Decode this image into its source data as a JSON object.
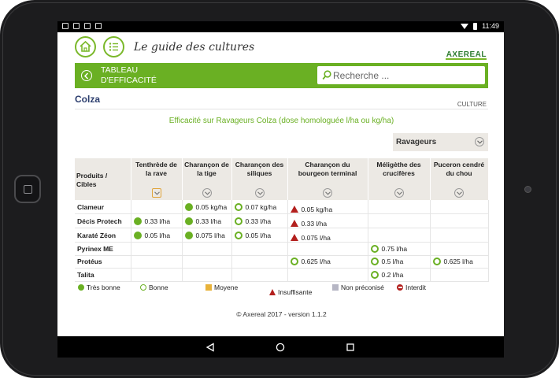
{
  "status_bar": {
    "time": "11:49"
  },
  "app": {
    "title": "Le guide des cultures",
    "logo": "AXEREAL"
  },
  "nav": {
    "title": "TABLEAU D'EFFICACITÉ",
    "search_placeholder": "Recherche ..."
  },
  "crop": {
    "name": "Colza",
    "label": "CULTURE"
  },
  "efficacy_title": "Efficacité sur Ravageurs Colza (dose homologuée l/ha ou kg/ha)",
  "filter": {
    "selected": "Ravageurs"
  },
  "table": {
    "header_first": "Produits / Cibles",
    "columns": [
      "Tenthrède de la rave",
      "Charançon de la tige",
      "Charançon des siliques",
      "Charançon du bourgeon terminal",
      "Méligèthe des crucifères",
      "Puceron cendré du chou"
    ],
    "rows": [
      {
        "product": "Clameur",
        "cells": [
          null,
          {
            "rating": "tres_bonne",
            "dose": "0.05 kg/ha"
          },
          {
            "rating": "bonne",
            "dose": "0.07 kg/ha"
          },
          {
            "rating": "insuffisante",
            "dose": "0.05 kg/ha"
          },
          null,
          null
        ]
      },
      {
        "product": "Décis Protech",
        "cells": [
          {
            "rating": "tres_bonne",
            "dose": "0.33 l/ha"
          },
          {
            "rating": "tres_bonne",
            "dose": "0.33 l/ha"
          },
          {
            "rating": "bonne",
            "dose": "0.33 l/ha"
          },
          {
            "rating": "insuffisante",
            "dose": "0.33 l/ha"
          },
          null,
          null
        ]
      },
      {
        "product": "Karaté Zéon",
        "cells": [
          {
            "rating": "tres_bonne",
            "dose": "0.05 l/ha"
          },
          {
            "rating": "tres_bonne",
            "dose": "0.075 l/ha"
          },
          {
            "rating": "bonne",
            "dose": "0.05 l/ha"
          },
          {
            "rating": "insuffisante",
            "dose": "0.075 l/ha"
          },
          null,
          null
        ]
      },
      {
        "product": "Pyrinex ME",
        "cells": [
          null,
          null,
          null,
          null,
          {
            "rating": "bonne",
            "dose": "0.75 l/ha"
          },
          null
        ]
      },
      {
        "product": "Protéus",
        "cells": [
          null,
          null,
          null,
          {
            "rating": "bonne",
            "dose": "0.625 l/ha"
          },
          {
            "rating": "bonne",
            "dose": "0.5 l/ha"
          },
          {
            "rating": "bonne",
            "dose": "0.625 l/ha"
          }
        ]
      },
      {
        "product": "Talita",
        "cells": [
          null,
          null,
          null,
          null,
          {
            "rating": "bonne",
            "dose": "0.2 l/ha"
          },
          null
        ]
      }
    ]
  },
  "legend": [
    {
      "key": "tres_bonne",
      "label": "Très bonne"
    },
    {
      "key": "bonne",
      "label": "Bonne"
    },
    {
      "key": "moyenne",
      "label": "Moyene"
    },
    {
      "key": "insuffisante",
      "label": "Insuffisante"
    },
    {
      "key": "non_preconise",
      "label": "Non préconisé"
    },
    {
      "key": "interdit",
      "label": "Interdit"
    }
  ],
  "footer": "© Axereal 2017 - version 1.1.2",
  "colors": {
    "brand_green": "#6ab023",
    "title_blue": "#2c3e6e",
    "insufficient_red": "#b3201e",
    "medium_orange": "#e8b23a",
    "not_recommended_grey": "#b6b6c4"
  }
}
